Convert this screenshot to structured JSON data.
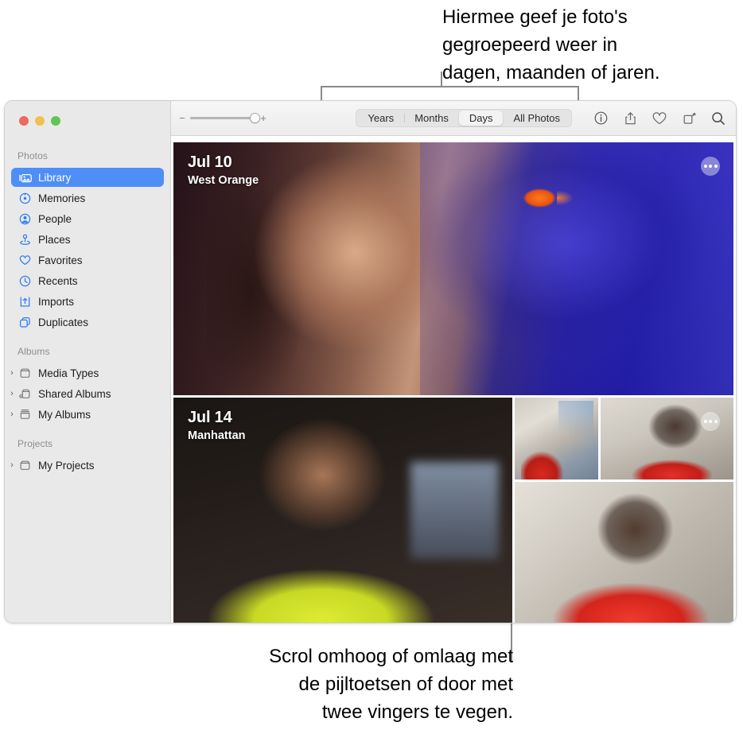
{
  "callouts": {
    "top": {
      "lines": [
        "Hiermee geef je foto's",
        "gegroepeerd weer in",
        "dagen, maanden of jaren."
      ]
    },
    "bottom": {
      "lines": [
        "Scrol omhoog of omlaag met",
        "de pijltoetsen of door met",
        "twee vingers te vegen."
      ]
    }
  },
  "window": {
    "traffic_lights": [
      {
        "name": "close",
        "color": "#ec6a5f"
      },
      {
        "name": "minimize",
        "color": "#f3bf4f"
      },
      {
        "name": "zoom",
        "color": "#61c454"
      }
    ]
  },
  "sidebar": {
    "sections": [
      {
        "header": "Photos",
        "items": [
          {
            "label": "Library",
            "icon": "library-icon",
            "selected": true
          },
          {
            "label": "Memories",
            "icon": "memories-icon",
            "selected": false
          },
          {
            "label": "People",
            "icon": "people-icon",
            "selected": false
          },
          {
            "label": "Places",
            "icon": "places-icon",
            "selected": false
          },
          {
            "label": "Favorites",
            "icon": "heart-icon",
            "selected": false
          },
          {
            "label": "Recents",
            "icon": "clock-icon",
            "selected": false
          },
          {
            "label": "Imports",
            "icon": "import-icon",
            "selected": false
          },
          {
            "label": "Duplicates",
            "icon": "duplicates-icon",
            "selected": false
          }
        ]
      },
      {
        "header": "Albums",
        "items": [
          {
            "label": "Media Types",
            "icon": "folder-icon",
            "twisty": "›"
          },
          {
            "label": "Shared Albums",
            "icon": "shared-folder-icon",
            "twisty": "›"
          },
          {
            "label": "My Albums",
            "icon": "folder-stack-icon",
            "twisty": "›"
          }
        ]
      },
      {
        "header": "Projects",
        "items": [
          {
            "label": "My Projects",
            "icon": "folder-icon",
            "twisty": "›"
          }
        ]
      }
    ]
  },
  "toolbar": {
    "zoom_slider": {
      "minus": "−",
      "plus": "+",
      "value": 85
    },
    "segments": [
      {
        "label": "Years",
        "active": false
      },
      {
        "label": "Months",
        "active": false
      },
      {
        "label": "Days",
        "active": true
      },
      {
        "label": "All Photos",
        "active": false
      }
    ],
    "icons": [
      {
        "name": "info-icon"
      },
      {
        "name": "share-icon"
      },
      {
        "name": "favorite-heart-icon"
      },
      {
        "name": "rotate-icon"
      },
      {
        "name": "search-icon"
      }
    ]
  },
  "photo_grid": {
    "days": [
      {
        "date": "Jul 10",
        "location": "West Orange",
        "more_label": "•••"
      },
      {
        "date": "Jul 14",
        "location": "Manhattan",
        "more_label": "•••"
      }
    ]
  },
  "colors": {
    "accent": "#4e8ef7",
    "sidebar_bg": "#e9e9e9",
    "toolbar_bg": "#ececec",
    "leader_line": "#8a8a8a"
  }
}
